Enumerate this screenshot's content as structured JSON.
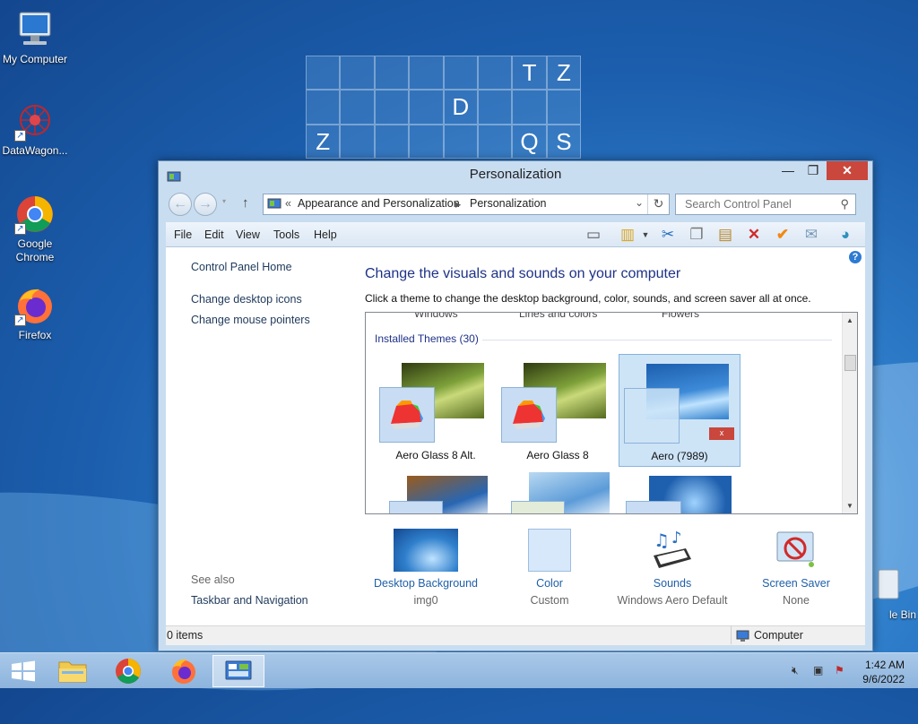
{
  "desktop": {
    "icons": [
      {
        "label": "My Computer",
        "icon": "computer-icon"
      },
      {
        "label": "DataWagon...",
        "icon": "datawagon-icon"
      },
      {
        "label": "Google Chrome",
        "icon": "chrome-icon"
      },
      {
        "label": "Firefox",
        "icon": "firefox-icon"
      }
    ],
    "recycle_bin_label": "le Bin",
    "grid_letters": [
      "",
      "",
      "",
      "",
      "",
      "",
      "T",
      "Z",
      "",
      "",
      "",
      "",
      "D",
      "",
      "",
      "",
      "Z",
      "",
      "",
      "",
      "",
      "",
      "Q",
      "S"
    ]
  },
  "window": {
    "title": "Personalization",
    "breadcrumb": [
      "Appearance and Personalization",
      "Personalization"
    ],
    "breadcrumb_prefix": "«",
    "search_placeholder": "Search Control Panel",
    "menu": [
      "File",
      "Edit",
      "View",
      "Tools",
      "Help"
    ],
    "sidebar": {
      "home": "Control Panel Home",
      "links": [
        "Change desktop icons",
        "Change mouse pointers"
      ],
      "see_also": "See also",
      "see_also_links": [
        "Taskbar and Navigation"
      ]
    },
    "heading": "Change the visuals and sounds on your computer",
    "subheading": "Click a theme to change the desktop background, color, sounds, and screen saver all at once.",
    "themes": {
      "cut_labels": [
        "Windows",
        "Lines and colors",
        "Flowers"
      ],
      "section_label": "Installed Themes (30)",
      "items": [
        {
          "label": "Aero Glass 8 Alt.",
          "selected": false
        },
        {
          "label": "Aero Glass 8",
          "selected": false
        },
        {
          "label": "Aero (7989)",
          "selected": true
        }
      ]
    },
    "bottom_items": [
      {
        "title": "Desktop Background",
        "value": "img0",
        "icon": "desktop-background-thumbnail"
      },
      {
        "title": "Color",
        "value": "Custom",
        "icon": "color-swatch"
      },
      {
        "title": "Sounds",
        "value": "Windows Aero Default",
        "icon": "sounds-icon"
      },
      {
        "title": "Screen Saver",
        "value": "None",
        "icon": "screen-saver-icon"
      }
    ],
    "status_left": "0 items",
    "status_right": "Computer"
  },
  "taskbar": {
    "time": "1:42 AM",
    "date": "9/6/2022"
  },
  "colors": {
    "link": "#1e5fa8",
    "heading": "#1e3287",
    "close": "#c9473c"
  }
}
